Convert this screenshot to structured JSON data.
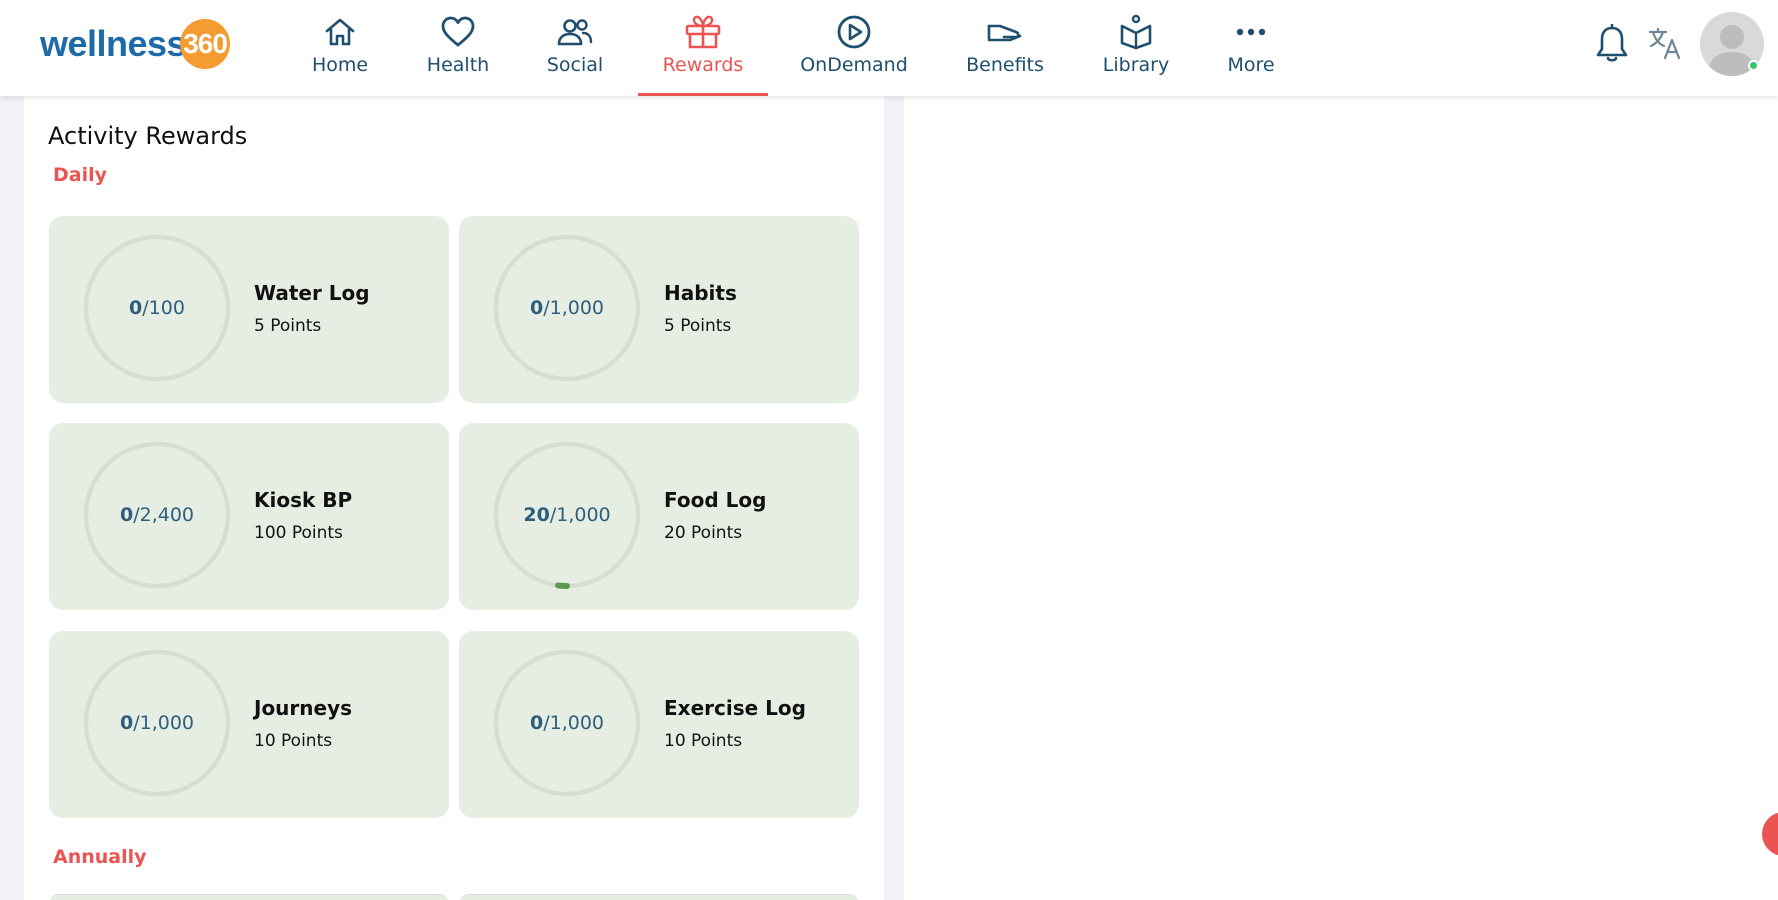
{
  "brand": {
    "word": "wellness",
    "badge": "360"
  },
  "nav": [
    {
      "label": "Home",
      "icon": "home-icon"
    },
    {
      "label": "Health",
      "icon": "heart-icon"
    },
    {
      "label": "Social",
      "icon": "people-icon"
    },
    {
      "label": "Rewards",
      "icon": "gift-icon",
      "active": true
    },
    {
      "label": "OnDemand",
      "icon": "play-circle-icon"
    },
    {
      "label": "Benefits",
      "icon": "hand-icon"
    },
    {
      "label": "Library",
      "icon": "book-icon"
    },
    {
      "label": "More",
      "icon": "more-dots-icon"
    }
  ],
  "header_icons": [
    "bell-icon",
    "translate-icon",
    "avatar"
  ],
  "colors": {
    "accent": "#ec5353",
    "nav_text": "#1f4e6e",
    "card_bg": "#e6eee4",
    "ring": "#d8ddd4",
    "progress": "#5d9a4f"
  },
  "rewards": {
    "title": "Activity Rewards",
    "daily_label": "Daily",
    "annual_label": "Annually",
    "cards": [
      {
        "value": "0",
        "target": "/100",
        "name": "Water Log",
        "points": "5 Points",
        "progress": 0
      },
      {
        "value": "0",
        "target": "/1,000",
        "name": "Habits",
        "points": "5 Points",
        "progress": 0
      },
      {
        "value": "0",
        "target": "/2,400",
        "name": "Kiosk BP",
        "points": "100 Points",
        "progress": 0
      },
      {
        "value": "20",
        "target": "/1,000",
        "name": "Food Log",
        "points": "20 Points",
        "progress": 0.02
      },
      {
        "value": "0",
        "target": "/1,000",
        "name": "Journeys",
        "points": "10 Points",
        "progress": 0
      },
      {
        "value": "0",
        "target": "/1,000",
        "name": "Exercise Log",
        "points": "10 Points",
        "progress": 0
      }
    ]
  }
}
